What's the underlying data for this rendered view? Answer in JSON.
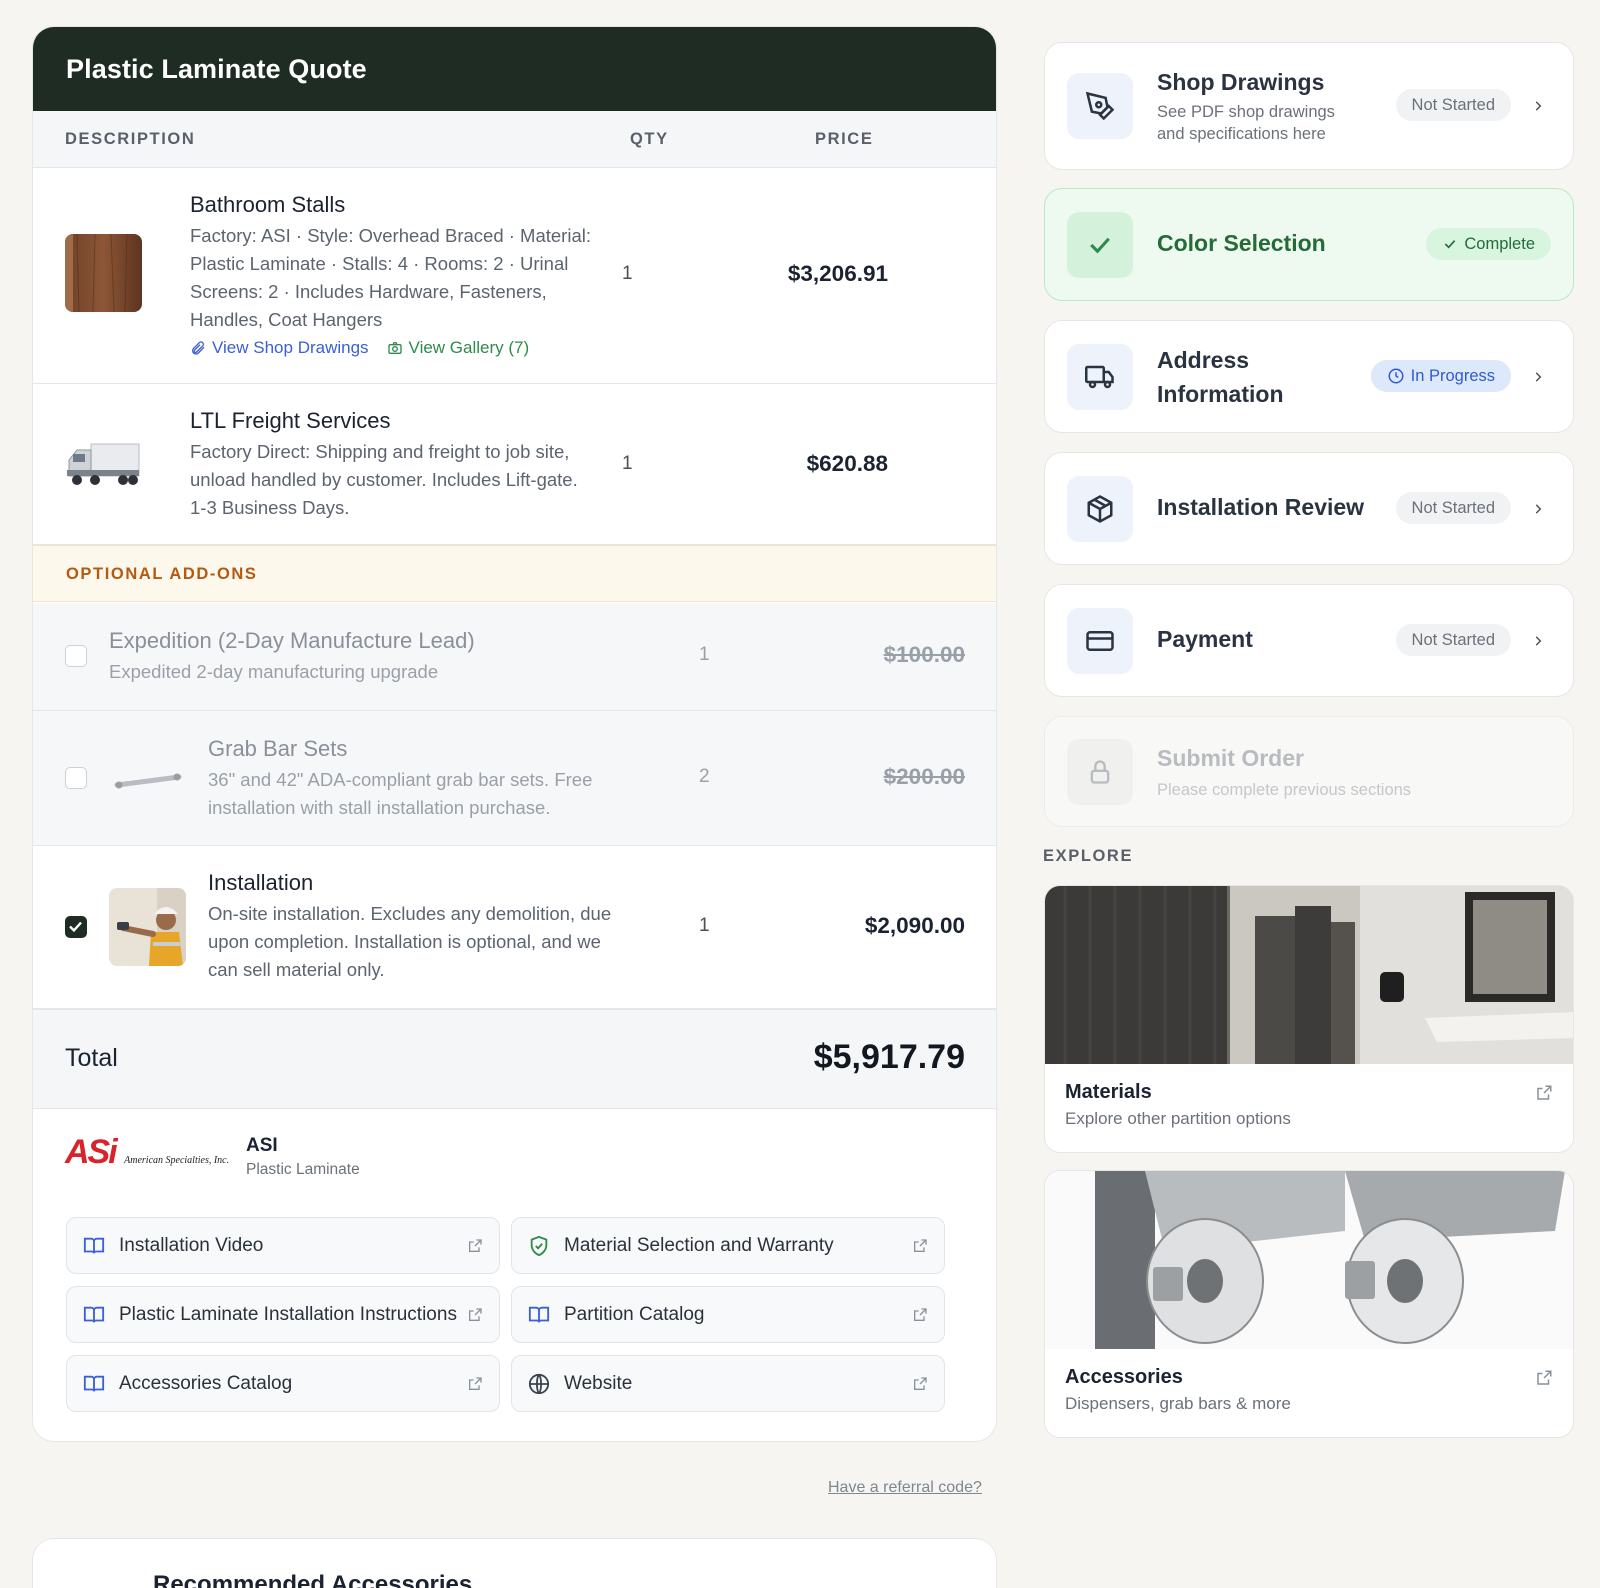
{
  "quote": {
    "title": "Plastic Laminate Quote",
    "columns": {
      "description": "DESCRIPTION",
      "qty": "QTY",
      "price": "PRICE"
    },
    "items": [
      {
        "title": "Bathroom Stalls",
        "description": "Factory: ASI · Style: Overhead Braced · Material: Plastic Laminate · Stalls: 4 · Rooms: 2 · Urinal Screens: 2 · Includes Hardware, Fasteners, Handles, Coat Hangers",
        "qty": "1",
        "price": "$3,206.91",
        "link_drawings": "View Shop Drawings",
        "link_gallery": "View Gallery (7)"
      },
      {
        "title": "LTL Freight Services",
        "description": "Factory Direct: Shipping and freight to job site, unload handled by customer. Includes Lift-gate. 1-3 Business Days.",
        "qty": "1",
        "price": "$620.88"
      }
    ],
    "addons_label": "OPTIONAL ADD-ONS",
    "addons": [
      {
        "title": "Expedition (2-Day Manufacture Lead)",
        "description": "Expedited 2-day manufacturing upgrade",
        "qty": "1",
        "price": "$100.00",
        "checked": false
      },
      {
        "title": "Grab Bar Sets",
        "description": "36\" and 42\" ADA-compliant grab bar sets. Free installation with stall installation purchase.",
        "qty": "2",
        "price": "$200.00",
        "checked": false
      },
      {
        "title": "Installation",
        "description": "On-site installation. Excludes any demolition, due upon completion. Installation is optional, and we can sell material only.",
        "qty": "1",
        "price": "$2,090.00",
        "checked": true
      }
    ],
    "total_label": "Total",
    "total_value": "$5,917.79",
    "vendor": {
      "logo_text": "ASi",
      "logo_sub": "American Specialties, Inc.",
      "name": "ASI",
      "sub": "Plastic Laminate"
    },
    "resources": [
      {
        "label": "Installation Video",
        "icon": "book-icon"
      },
      {
        "label": "Material Selection and Warranty",
        "icon": "shield-check-icon"
      },
      {
        "label": "Plastic Laminate Installation Instructions",
        "icon": "book-icon"
      },
      {
        "label": "Partition Catalog",
        "icon": "book-icon"
      },
      {
        "label": "Accessories Catalog",
        "icon": "book-icon"
      },
      {
        "label": "Website",
        "icon": "globe-icon"
      }
    ],
    "referral": "Have a referral code?",
    "recommended_title": "Recommended Accessories"
  },
  "steps": [
    {
      "title": "Shop Drawings",
      "subtitle": "See PDF shop drawings and specifications here",
      "status": "Not Started",
      "icon": "pen-tool-icon"
    },
    {
      "title": "Color Selection",
      "status": "Complete",
      "icon": "check-icon"
    },
    {
      "title": "Address Information",
      "status": "In Progress",
      "icon": "truck-icon"
    },
    {
      "title": "Installation Review",
      "status": "Not Started",
      "icon": "package-icon"
    },
    {
      "title": "Payment",
      "status": "Not Started",
      "icon": "credit-card-icon"
    },
    {
      "title": "Submit Order",
      "subtitle": "Please complete previous sections",
      "icon": "lock-icon"
    }
  ],
  "explore": {
    "label": "EXPLORE",
    "cards": [
      {
        "title": "Materials",
        "subtitle": "Explore other partition options"
      },
      {
        "title": "Accessories",
        "subtitle": "Dispensers, grab bars & more"
      }
    ]
  },
  "colors": {
    "header": "#1e2c24",
    "accent_green": "#2f8a4b",
    "accent_blue": "#3a5fd6",
    "addon_orange": "#b35a12"
  }
}
